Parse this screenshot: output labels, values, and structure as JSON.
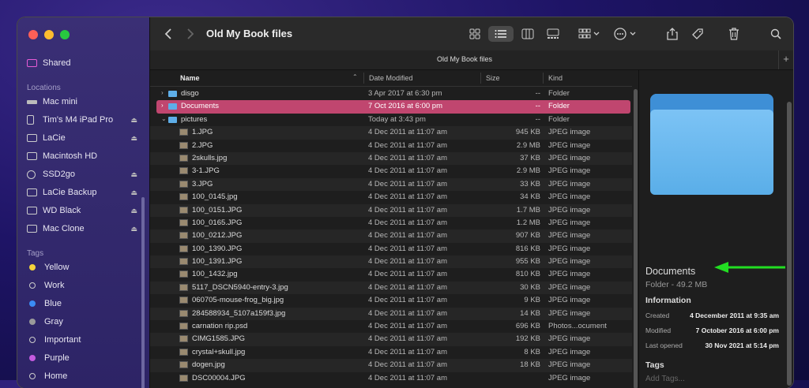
{
  "window": {
    "title": "Old My Book files",
    "tab_title": "Old My Book files"
  },
  "colors": {
    "selected_row": "#c0466f",
    "arrow": "#22dd22",
    "folder": "#5eaee8"
  },
  "sidebar": {
    "shared": "Shared",
    "locations_header": "Locations",
    "locations": [
      {
        "label": "Mac mini",
        "icon": "mac-mini-icon",
        "eject": false
      },
      {
        "label": "Tim's M4 iPad Pro",
        "icon": "ipad-icon",
        "eject": true
      },
      {
        "label": "LaCie",
        "icon": "drive-icon",
        "eject": true
      },
      {
        "label": "Macintosh HD",
        "icon": "drive-icon",
        "eject": false
      },
      {
        "label": "SSD2go",
        "icon": "timemachine-icon",
        "eject": true
      },
      {
        "label": "LaCie Backup",
        "icon": "drive-icon",
        "eject": true
      },
      {
        "label": "WD Black",
        "icon": "drive-icon",
        "eject": true
      },
      {
        "label": "Mac Clone",
        "icon": "drive-icon",
        "eject": true
      }
    ],
    "tags_header": "Tags",
    "tags": [
      {
        "label": "Yellow",
        "color": "#f5d33b"
      },
      {
        "label": "Work",
        "color": "outline"
      },
      {
        "label": "Blue",
        "color": "#3b8cf5"
      },
      {
        "label": "Gray",
        "color": "#9a9a9a"
      },
      {
        "label": "Important",
        "color": "outline"
      },
      {
        "label": "Purple",
        "color": "#c55be0"
      },
      {
        "label": "Home",
        "color": "outline"
      }
    ]
  },
  "columns": {
    "name": "Name",
    "date": "Date Modified",
    "size": "Size",
    "kind": "Kind"
  },
  "rows": [
    {
      "name": "disgo",
      "date": "3 Apr 2017 at 6:30 pm",
      "size": "--",
      "kind": "Folder",
      "type": "folder",
      "disclosure": "›"
    },
    {
      "name": "Documents",
      "date": "7 Oct 2016 at 6:00 pm",
      "size": "--",
      "kind": "Folder",
      "type": "folder",
      "disclosure": "›",
      "selected": true
    },
    {
      "name": "pictures",
      "date": "Today at 3:43 pm",
      "size": "--",
      "kind": "Folder",
      "type": "folder",
      "disclosure": "⌄"
    },
    {
      "name": "1.JPG",
      "date": "4 Dec 2011 at 11:07 am",
      "size": "945 KB",
      "kind": "JPEG image",
      "type": "file"
    },
    {
      "name": "2.JPG",
      "date": "4 Dec 2011 at 11:07 am",
      "size": "2.9 MB",
      "kind": "JPEG image",
      "type": "file"
    },
    {
      "name": "2skulls.jpg",
      "date": "4 Dec 2011 at 11:07 am",
      "size": "37 KB",
      "kind": "JPEG image",
      "type": "file"
    },
    {
      "name": "3-1.JPG",
      "date": "4 Dec 2011 at 11:07 am",
      "size": "2.9 MB",
      "kind": "JPEG image",
      "type": "file"
    },
    {
      "name": "3.JPG",
      "date": "4 Dec 2011 at 11:07 am",
      "size": "33 KB",
      "kind": "JPEG image",
      "type": "file"
    },
    {
      "name": "100_0145.jpg",
      "date": "4 Dec 2011 at 11:07 am",
      "size": "34 KB",
      "kind": "JPEG image",
      "type": "file"
    },
    {
      "name": "100_0151.JPG",
      "date": "4 Dec 2011 at 11:07 am",
      "size": "1.7 MB",
      "kind": "JPEG image",
      "type": "file"
    },
    {
      "name": "100_0165.JPG",
      "date": "4 Dec 2011 at 11:07 am",
      "size": "1.2 MB",
      "kind": "JPEG image",
      "type": "file"
    },
    {
      "name": "100_0212.JPG",
      "date": "4 Dec 2011 at 11:07 am",
      "size": "907 KB",
      "kind": "JPEG image",
      "type": "file"
    },
    {
      "name": "100_1390.JPG",
      "date": "4 Dec 2011 at 11:07 am",
      "size": "816 KB",
      "kind": "JPEG image",
      "type": "file"
    },
    {
      "name": "100_1391.JPG",
      "date": "4 Dec 2011 at 11:07 am",
      "size": "955 KB",
      "kind": "JPEG image",
      "type": "file"
    },
    {
      "name": "100_1432.jpg",
      "date": "4 Dec 2011 at 11:07 am",
      "size": "810 KB",
      "kind": "JPEG image",
      "type": "file"
    },
    {
      "name": "5117_DSCN5940-entry-3.jpg",
      "date": "4 Dec 2011 at 11:07 am",
      "size": "30 KB",
      "kind": "JPEG image",
      "type": "file"
    },
    {
      "name": "060705-mouse-frog_big.jpg",
      "date": "4 Dec 2011 at 11:07 am",
      "size": "9 KB",
      "kind": "JPEG image",
      "type": "file"
    },
    {
      "name": "284588934_5107a159f3.jpg",
      "date": "4 Dec 2011 at 11:07 am",
      "size": "14 KB",
      "kind": "JPEG image",
      "type": "file"
    },
    {
      "name": "carnation rip.psd",
      "date": "4 Dec 2011 at 11:07 am",
      "size": "696 KB",
      "kind": "Photos...ocument",
      "type": "file"
    },
    {
      "name": "CIMG1585.JPG",
      "date": "4 Dec 2011 at 11:07 am",
      "size": "192 KB",
      "kind": "JPEG image",
      "type": "file"
    },
    {
      "name": "crystal+skull.jpg",
      "date": "4 Dec 2011 at 11:07 am",
      "size": "8 KB",
      "kind": "JPEG image",
      "type": "file"
    },
    {
      "name": "dogen.jpg",
      "date": "4 Dec 2011 at 11:07 am",
      "size": "18 KB",
      "kind": "JPEG image",
      "type": "file"
    },
    {
      "name": "DSC00004.JPG",
      "date": "4 Dec 2011 at 11:07 am",
      "size": "",
      "kind": "JPEG image",
      "type": "file"
    }
  ],
  "preview": {
    "name": "Documents",
    "subtitle": "Folder - 49.2 MB",
    "info_header": "Information",
    "info": [
      {
        "label": "Created",
        "value": "4 December 2011 at 9:35 am"
      },
      {
        "label": "Modified",
        "value": "7 October 2016 at 6:00 pm"
      },
      {
        "label": "Last opened",
        "value": "30 Nov 2021 at 5:14 pm"
      }
    ],
    "tags_header": "Tags",
    "add_tags": "Add Tags..."
  }
}
